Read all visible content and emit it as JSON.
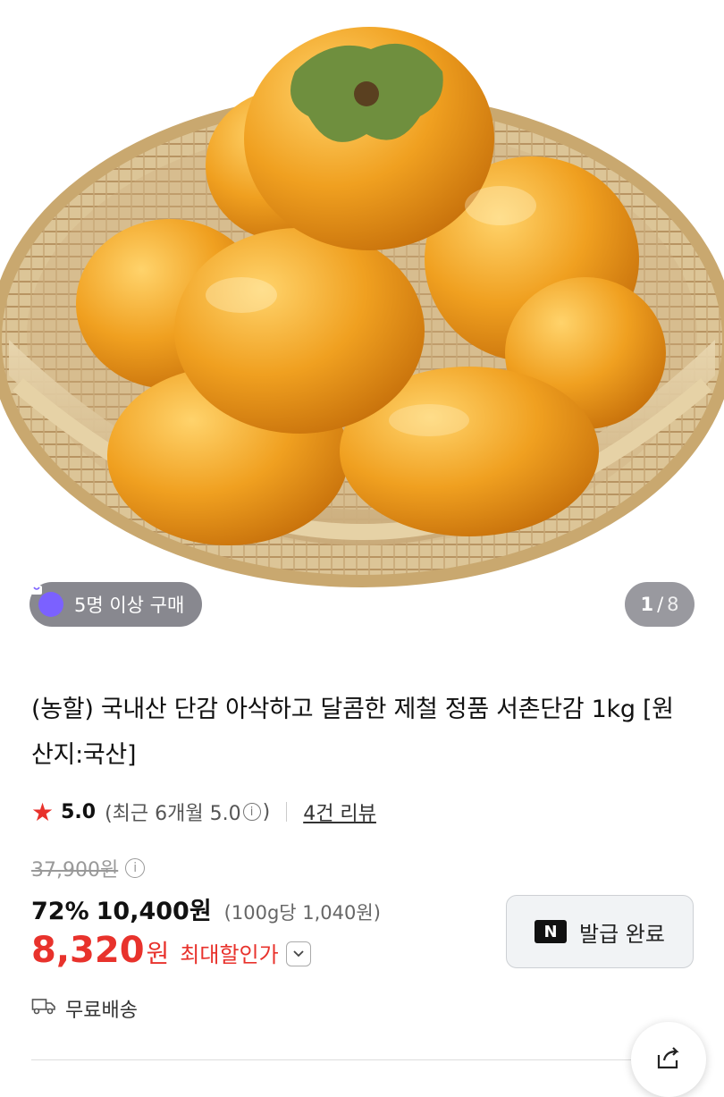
{
  "gallery": {
    "badge_text": "5명 이상 구매",
    "counter_current": "1",
    "counter_sep": "/",
    "counter_total": "8"
  },
  "product": {
    "title": "(농할) 국내산 단감 아삭하고 달콤한 제철 정품 서촌단감 1kg [원산지:국산]",
    "rating_score": "5.0",
    "rating_recent_prefix": "(최근 6개월 5.0",
    "rating_recent_suffix": ")",
    "review_link": "4건 리뷰",
    "original_price": "37,900원",
    "discount_percent": "72%",
    "sale_price": "10,400원",
    "unit_price": "(100g당 1,040원)",
    "max_discount_price": "8,320",
    "max_discount_won": "원",
    "max_discount_label": "최대할인가",
    "shipping": "무료배송"
  },
  "coupon": {
    "logo": "N",
    "label": "발급 완료"
  },
  "colors": {
    "accent_red": "#e8322c",
    "badge_purple": "#7b61ff",
    "persimmon": "#f0a020"
  },
  "icons": [
    "bag-icon",
    "star-icon",
    "info-icon",
    "chevron-down-icon",
    "truck-icon",
    "share-icon"
  ]
}
